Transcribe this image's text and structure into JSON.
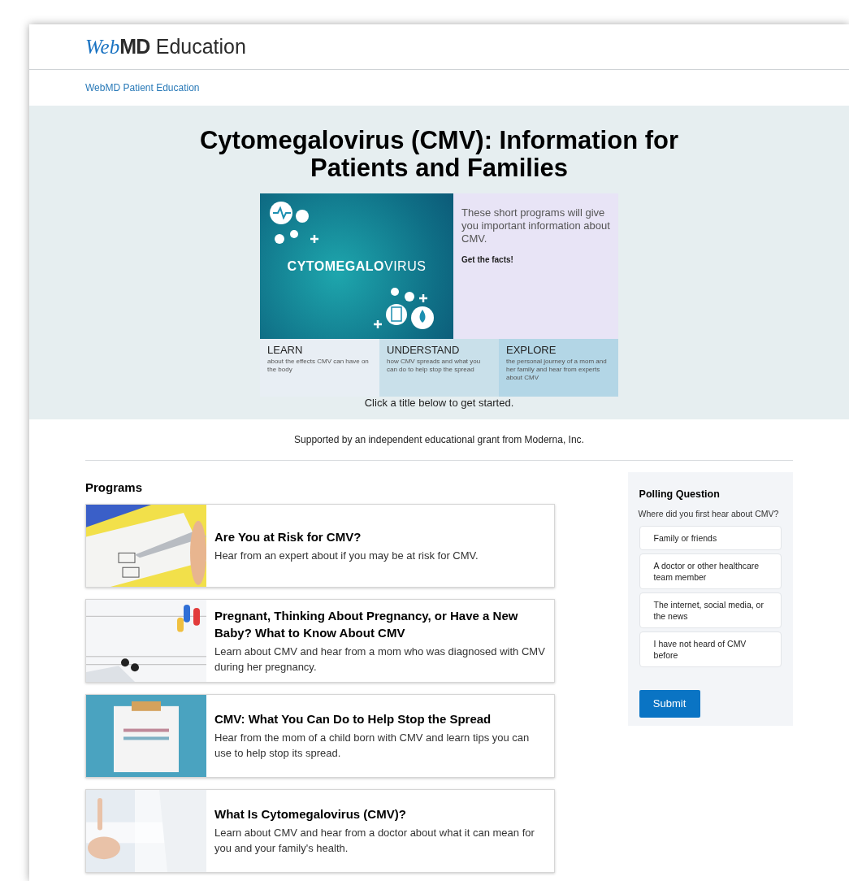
{
  "header": {
    "logo_web": "Web",
    "logo_md": "MD",
    "logo_suffix": "Education"
  },
  "breadcrumb": "WebMD Patient Education",
  "hero": {
    "title": "Cytomegalovirus (CMV): Information for Patients and Families",
    "banner": {
      "graphic_title_bold": "CYTOMEGALO",
      "graphic_title_light": "VIRUS",
      "intro": "These short programs will give you important information about CMV.",
      "cta": "Get the facts!",
      "sections": [
        {
          "heading": "LEARN",
          "text": "about the effects CMV can have on the body",
          "color": "#e8eef4"
        },
        {
          "heading": "UNDERSTAND",
          "text": "how CMV spreads and what you can do to help stop the spread",
          "color": "#c9e0ea"
        },
        {
          "heading": "EXPLORE",
          "text": "the personal journey of a mom and her family and hear from experts about CMV",
          "color": "#b3d6e6"
        }
      ]
    },
    "caption": "Click a title below to get started."
  },
  "support": "Supported by an independent educational grant from Moderna, Inc.",
  "programs": {
    "heading": "Programs",
    "items": [
      {
        "title": "Are You at Risk for CMV?",
        "description": "Hear from an expert about if you may be at risk for CMV.",
        "kind": "picture"
      },
      {
        "title": "Pregnant, Thinking About Pregnancy, or Have a New Baby? What to Know About CMV",
        "description": "Learn about CMV and hear from a mom who was diagnosed with CMV during her pregnancy.",
        "kind": "picture"
      },
      {
        "title": "CMV: What You Can Do to Help Stop the Spread",
        "description": "Hear from the mom of a child born with CMV and learn tips you can use to help stop its spread.",
        "kind": "picture"
      },
      {
        "title": "What Is Cytomegalovirus (CMV)?",
        "description": "Learn about CMV and hear from a doctor about what it can mean for you and your family's health.",
        "kind": "picture"
      }
    ]
  },
  "poll": {
    "heading": "Polling Question",
    "question": "Where did you first hear about CMV?",
    "options": [
      {
        "label": "Family or friends",
        "selected": false
      },
      {
        "label": "A doctor or other healthcare team member",
        "selected": false
      },
      {
        "label": "The internet, social media, or the news",
        "selected": false
      },
      {
        "label": "I have not heard of CMV before",
        "selected": false
      }
    ],
    "submit": "Submit"
  }
}
